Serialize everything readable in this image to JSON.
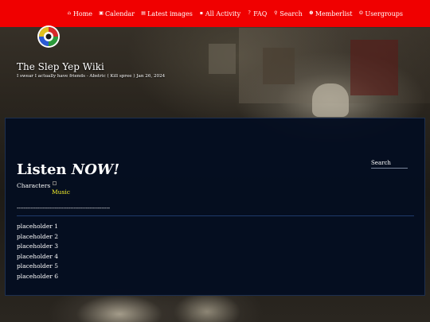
{
  "nav": {
    "items": [
      {
        "label": "Home",
        "icon": "home-icon"
      },
      {
        "label": "Calendar",
        "icon": "calendar-icon"
      },
      {
        "label": "Latest images",
        "icon": "images-icon"
      },
      {
        "label": "All Activity",
        "icon": "activity-icon"
      },
      {
        "label": "FAQ",
        "icon": "faq-icon"
      },
      {
        "label": "Search",
        "icon": "search-icon"
      },
      {
        "label": "Memberlist",
        "icon": "members-icon"
      },
      {
        "label": "Usergroups",
        "icon": "usergroups-icon"
      }
    ],
    "bg_color": "#f00000"
  },
  "header": {
    "title": "The Slep Yep Wiki",
    "subtitle": "I swear I actually have friends - Abstric ( Kill spree ) Jan 26, 2024"
  },
  "main": {
    "heading_part1": "Listen",
    "heading_part2": "NOW!",
    "search_label": "Search",
    "link_characters": "Characters",
    "link_music": "Music",
    "separator": "------------------------------------------------------",
    "placeholders": [
      "placeholder 1",
      "placeholder 2",
      "placeholder 3",
      "placeholder 4",
      "placeholder 5",
      "placeholder 6"
    ],
    "panel_color": "#040e20",
    "music_color": "#f5f02a"
  }
}
